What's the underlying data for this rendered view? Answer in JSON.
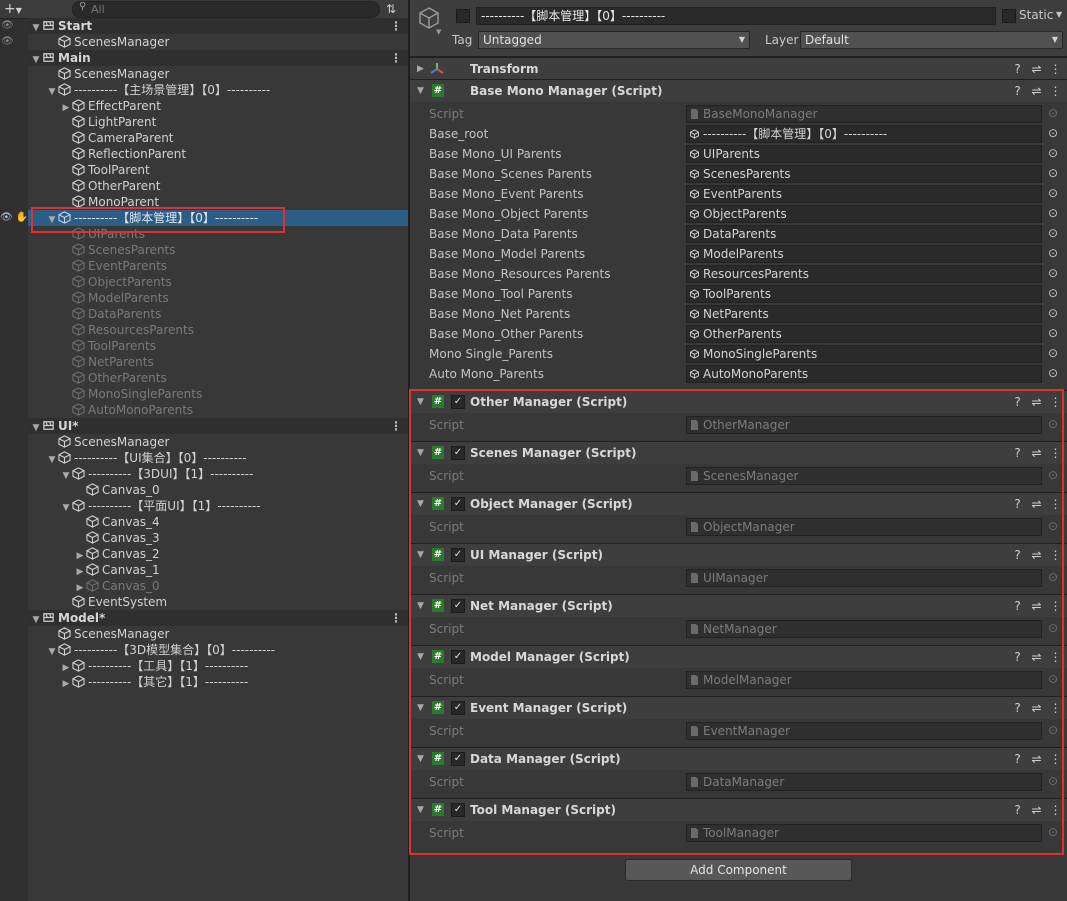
{
  "hierarchy": {
    "search_placeholder": "All",
    "rows": [
      {
        "text": "Start",
        "type": "scene",
        "indent": 0,
        "arrow": "down"
      },
      {
        "text": "ScenesManager",
        "type": "item",
        "indent": 1,
        "arrow": ""
      },
      {
        "text": "Main",
        "type": "scene",
        "indent": 0,
        "arrow": "down"
      },
      {
        "text": "ScenesManager",
        "type": "item",
        "indent": 1,
        "arrow": ""
      },
      {
        "text": "----------【主场景管理】【0】----------",
        "type": "item",
        "indent": 1,
        "arrow": "down"
      },
      {
        "text": "EffectParent",
        "type": "item",
        "indent": 2,
        "arrow": "right"
      },
      {
        "text": "LightParent",
        "type": "item",
        "indent": 2,
        "arrow": ""
      },
      {
        "text": "CameraParent",
        "type": "item",
        "indent": 2,
        "arrow": ""
      },
      {
        "text": "ReflectionParent",
        "type": "item",
        "indent": 2,
        "arrow": ""
      },
      {
        "text": "ToolParent",
        "type": "item",
        "indent": 2,
        "arrow": ""
      },
      {
        "text": "OtherParent",
        "type": "item",
        "indent": 2,
        "arrow": ""
      },
      {
        "text": "MonoParent",
        "type": "item",
        "indent": 2,
        "arrow": ""
      },
      {
        "text": "----------【脚本管理】【0】----------",
        "type": "selected",
        "indent": 1,
        "arrow": "down"
      },
      {
        "text": "UIParents",
        "type": "dim",
        "indent": 2,
        "arrow": ""
      },
      {
        "text": "ScenesParents",
        "type": "dim",
        "indent": 2,
        "arrow": ""
      },
      {
        "text": "EventParents",
        "type": "dim",
        "indent": 2,
        "arrow": ""
      },
      {
        "text": "ObjectParents",
        "type": "dim",
        "indent": 2,
        "arrow": ""
      },
      {
        "text": "ModelParents",
        "type": "dim",
        "indent": 2,
        "arrow": ""
      },
      {
        "text": "DataParents",
        "type": "dim",
        "indent": 2,
        "arrow": ""
      },
      {
        "text": "ResourcesParents",
        "type": "dim",
        "indent": 2,
        "arrow": ""
      },
      {
        "text": "ToolParents",
        "type": "dim",
        "indent": 2,
        "arrow": ""
      },
      {
        "text": "NetParents",
        "type": "dim",
        "indent": 2,
        "arrow": ""
      },
      {
        "text": "OtherParents",
        "type": "dim",
        "indent": 2,
        "arrow": ""
      },
      {
        "text": "MonoSingleParents",
        "type": "dim",
        "indent": 2,
        "arrow": ""
      },
      {
        "text": "AutoMonoParents",
        "type": "dim",
        "indent": 2,
        "arrow": ""
      },
      {
        "text": "UI*",
        "type": "scene",
        "indent": 0,
        "arrow": "down"
      },
      {
        "text": "ScenesManager",
        "type": "item",
        "indent": 1,
        "arrow": ""
      },
      {
        "text": "----------【UI集合】【0】----------",
        "type": "item",
        "indent": 1,
        "arrow": "down"
      },
      {
        "text": "----------【3DUI】【1】----------",
        "type": "item",
        "indent": 2,
        "arrow": "down"
      },
      {
        "text": "Canvas_0",
        "type": "item",
        "indent": 3,
        "arrow": ""
      },
      {
        "text": "----------【平面UI】【1】----------",
        "type": "item",
        "indent": 2,
        "arrow": "down"
      },
      {
        "text": "Canvas_4",
        "type": "item",
        "indent": 3,
        "arrow": ""
      },
      {
        "text": "Canvas_3",
        "type": "item",
        "indent": 3,
        "arrow": ""
      },
      {
        "text": "Canvas_2",
        "type": "item",
        "indent": 3,
        "arrow": "right"
      },
      {
        "text": "Canvas_1",
        "type": "item",
        "indent": 3,
        "arrow": "right"
      },
      {
        "text": "Canvas_0",
        "type": "dim",
        "indent": 3,
        "arrow": "right"
      },
      {
        "text": "EventSystem",
        "type": "item",
        "indent": 2,
        "arrow": ""
      },
      {
        "text": "Model*",
        "type": "scene",
        "indent": 0,
        "arrow": "down"
      },
      {
        "text": "ScenesManager",
        "type": "item",
        "indent": 1,
        "arrow": ""
      },
      {
        "text": "----------【3D模型集合】【0】----------",
        "type": "item",
        "indent": 1,
        "arrow": "down"
      },
      {
        "text": "----------【工具】【1】----------",
        "type": "item",
        "indent": 2,
        "arrow": "right"
      },
      {
        "text": "----------【其它】【1】----------",
        "type": "item",
        "indent": 2,
        "arrow": "right"
      }
    ]
  },
  "inspector": {
    "object_name": "----------【脚本管理】【0】----------",
    "static_label": "Static",
    "tag_label": "Tag",
    "tag_value": "Untagged",
    "layer_label": "Layer",
    "layer_value": "Default",
    "transform_title": "Transform",
    "base_mono": {
      "title": "Base Mono Manager (Script)",
      "fields": [
        {
          "label": "Script",
          "value": "BaseMonoManager",
          "dim": true
        },
        {
          "label": "Base_root",
          "value": "----------【脚本管理】【0】----------",
          "dim": false
        },
        {
          "label": "Base Mono_UI Parents",
          "value": "UIParents",
          "dim": false
        },
        {
          "label": "Base Mono_Scenes Parents",
          "value": "ScenesParents",
          "dim": false
        },
        {
          "label": "Base Mono_Event Parents",
          "value": "EventParents",
          "dim": false
        },
        {
          "label": "Base Mono_Object Parents",
          "value": "ObjectParents",
          "dim": false
        },
        {
          "label": "Base Mono_Data Parents",
          "value": "DataParents",
          "dim": false
        },
        {
          "label": "Base Mono_Model Parents",
          "value": "ModelParents",
          "dim": false
        },
        {
          "label": "Base Mono_Resources Parents",
          "value": "ResourcesParents",
          "dim": false
        },
        {
          "label": "Base Mono_Tool Parents",
          "value": "ToolParents",
          "dim": false
        },
        {
          "label": "Base Mono_Net Parents",
          "value": "NetParents",
          "dim": false
        },
        {
          "label": "Base Mono_Other Parents",
          "value": "OtherParents",
          "dim": false
        },
        {
          "label": "Mono Single_Parents",
          "value": "MonoSingleParents",
          "dim": false
        },
        {
          "label": "Auto Mono_Parents",
          "value": "AutoMonoParents",
          "dim": false
        }
      ]
    },
    "managers": [
      {
        "title": "Other Manager (Script)",
        "script": "OtherManager"
      },
      {
        "title": "Scenes Manager (Script)",
        "script": "ScenesManager"
      },
      {
        "title": "Object Manager (Script)",
        "script": "ObjectManager"
      },
      {
        "title": "UI Manager (Script)",
        "script": "UIManager"
      },
      {
        "title": "Net Manager (Script)",
        "script": "NetManager"
      },
      {
        "title": "Model Manager (Script)",
        "script": "ModelManager"
      },
      {
        "title": "Event Manager (Script)",
        "script": "EventManager"
      },
      {
        "title": "Data Manager (Script)",
        "script": "DataManager"
      },
      {
        "title": "Tool Manager (Script)",
        "script": "ToolManager"
      }
    ],
    "script_label": "Script",
    "add_component": "Add Component"
  },
  "colors": {
    "selection": "#2c5d87",
    "highlight": "#e03131",
    "script_icon": "#2c7a2c"
  }
}
